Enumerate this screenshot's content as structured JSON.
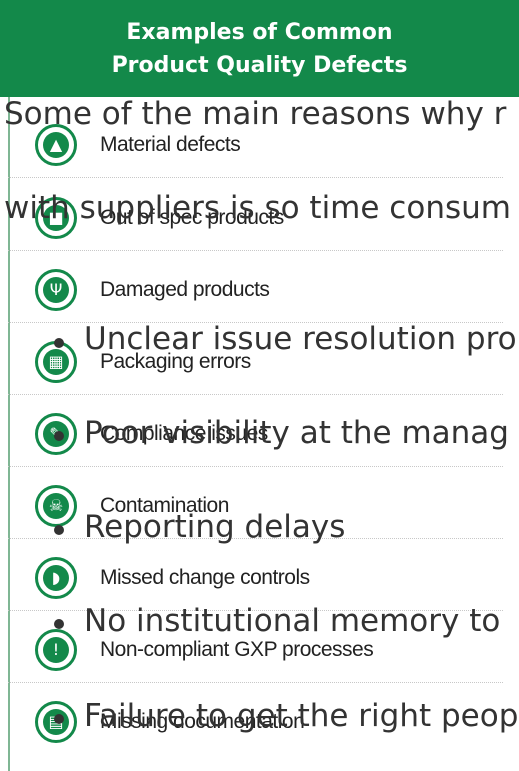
{
  "infographic": {
    "title_line1": "Examples of Common",
    "title_line2": "Product Quality Defects",
    "items": [
      {
        "label": "Material defects",
        "icon": "warning-icon",
        "glyph": "▲"
      },
      {
        "label": "Out of spec products",
        "icon": "box-icon",
        "glyph": "■"
      },
      {
        "label": "Damaged products",
        "icon": "broken-glass-icon",
        "glyph": "Ψ"
      },
      {
        "label": "Packaging errors",
        "icon": "package-icon",
        "glyph": "▦"
      },
      {
        "label": "Compliance issues",
        "icon": "gavel-icon",
        "glyph": "✎"
      },
      {
        "label": "Contamination",
        "icon": "skull-icon",
        "glyph": "☠"
      },
      {
        "label": "Missed change controls",
        "icon": "binoculars-icon",
        "glyph": "◗"
      },
      {
        "label": "Non-compliant GXP processes",
        "icon": "alert-badge-icon",
        "glyph": "!"
      },
      {
        "label": "Missing documentation",
        "icon": "document-search-icon",
        "glyph": "▤"
      }
    ]
  },
  "overlay_text": {
    "line1": "Some of the main reasons why r",
    "line2": "with suppliers is so time consum",
    "bullets": [
      "Unclear issue resolution pro",
      "Poor visibility at the manag",
      "Reporting delays",
      "No institutional memory to",
      "Failure to get the right peop"
    ]
  },
  "colors": {
    "brand_green": "#13894a",
    "text": "#333333"
  }
}
